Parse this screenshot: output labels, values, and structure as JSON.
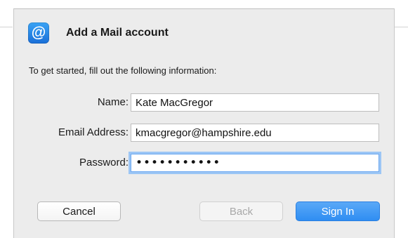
{
  "dialog": {
    "title": "Add a Mail account",
    "icon_glyph": "@",
    "icon_name": "mail-at-icon",
    "intro": "To get started, fill out the following information:"
  },
  "form": {
    "name_label": "Name:",
    "name_value": "Kate MacGregor",
    "email_label": "Email Address:",
    "email_value": "kmacgregor@hampshire.edu",
    "password_label": "Password:",
    "password_masked": "•••••••••••"
  },
  "buttons": {
    "cancel": "Cancel",
    "back": "Back",
    "sign_in": "Sign In"
  },
  "colors": {
    "accent": "#2f8df2",
    "focus_ring": "#9cc6f5",
    "dialog_bg": "#ececec"
  }
}
